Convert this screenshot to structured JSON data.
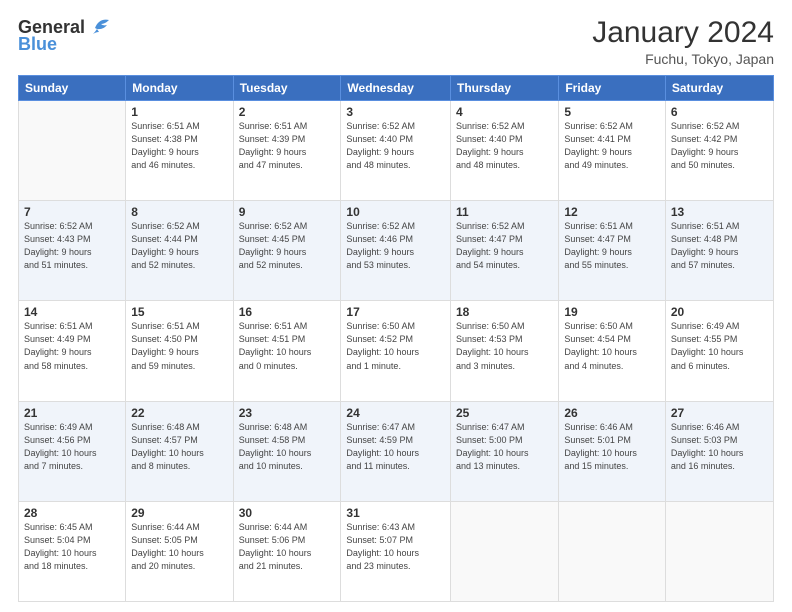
{
  "header": {
    "logo_line1": "General",
    "logo_line2": "Blue",
    "month_title": "January 2024",
    "location": "Fuchu, Tokyo, Japan"
  },
  "weekdays": [
    "Sunday",
    "Monday",
    "Tuesday",
    "Wednesday",
    "Thursday",
    "Friday",
    "Saturday"
  ],
  "weeks": [
    [
      {
        "day": "",
        "info": ""
      },
      {
        "day": "1",
        "info": "Sunrise: 6:51 AM\nSunset: 4:38 PM\nDaylight: 9 hours\nand 46 minutes."
      },
      {
        "day": "2",
        "info": "Sunrise: 6:51 AM\nSunset: 4:39 PM\nDaylight: 9 hours\nand 47 minutes."
      },
      {
        "day": "3",
        "info": "Sunrise: 6:52 AM\nSunset: 4:40 PM\nDaylight: 9 hours\nand 48 minutes."
      },
      {
        "day": "4",
        "info": "Sunrise: 6:52 AM\nSunset: 4:40 PM\nDaylight: 9 hours\nand 48 minutes."
      },
      {
        "day": "5",
        "info": "Sunrise: 6:52 AM\nSunset: 4:41 PM\nDaylight: 9 hours\nand 49 minutes."
      },
      {
        "day": "6",
        "info": "Sunrise: 6:52 AM\nSunset: 4:42 PM\nDaylight: 9 hours\nand 50 minutes."
      }
    ],
    [
      {
        "day": "7",
        "info": "Sunrise: 6:52 AM\nSunset: 4:43 PM\nDaylight: 9 hours\nand 51 minutes."
      },
      {
        "day": "8",
        "info": "Sunrise: 6:52 AM\nSunset: 4:44 PM\nDaylight: 9 hours\nand 52 minutes."
      },
      {
        "day": "9",
        "info": "Sunrise: 6:52 AM\nSunset: 4:45 PM\nDaylight: 9 hours\nand 52 minutes."
      },
      {
        "day": "10",
        "info": "Sunrise: 6:52 AM\nSunset: 4:46 PM\nDaylight: 9 hours\nand 53 minutes."
      },
      {
        "day": "11",
        "info": "Sunrise: 6:52 AM\nSunset: 4:47 PM\nDaylight: 9 hours\nand 54 minutes."
      },
      {
        "day": "12",
        "info": "Sunrise: 6:51 AM\nSunset: 4:47 PM\nDaylight: 9 hours\nand 55 minutes."
      },
      {
        "day": "13",
        "info": "Sunrise: 6:51 AM\nSunset: 4:48 PM\nDaylight: 9 hours\nand 57 minutes."
      }
    ],
    [
      {
        "day": "14",
        "info": "Sunrise: 6:51 AM\nSunset: 4:49 PM\nDaylight: 9 hours\nand 58 minutes."
      },
      {
        "day": "15",
        "info": "Sunrise: 6:51 AM\nSunset: 4:50 PM\nDaylight: 9 hours\nand 59 minutes."
      },
      {
        "day": "16",
        "info": "Sunrise: 6:51 AM\nSunset: 4:51 PM\nDaylight: 10 hours\nand 0 minutes."
      },
      {
        "day": "17",
        "info": "Sunrise: 6:50 AM\nSunset: 4:52 PM\nDaylight: 10 hours\nand 1 minute."
      },
      {
        "day": "18",
        "info": "Sunrise: 6:50 AM\nSunset: 4:53 PM\nDaylight: 10 hours\nand 3 minutes."
      },
      {
        "day": "19",
        "info": "Sunrise: 6:50 AM\nSunset: 4:54 PM\nDaylight: 10 hours\nand 4 minutes."
      },
      {
        "day": "20",
        "info": "Sunrise: 6:49 AM\nSunset: 4:55 PM\nDaylight: 10 hours\nand 6 minutes."
      }
    ],
    [
      {
        "day": "21",
        "info": "Sunrise: 6:49 AM\nSunset: 4:56 PM\nDaylight: 10 hours\nand 7 minutes."
      },
      {
        "day": "22",
        "info": "Sunrise: 6:48 AM\nSunset: 4:57 PM\nDaylight: 10 hours\nand 8 minutes."
      },
      {
        "day": "23",
        "info": "Sunrise: 6:48 AM\nSunset: 4:58 PM\nDaylight: 10 hours\nand 10 minutes."
      },
      {
        "day": "24",
        "info": "Sunrise: 6:47 AM\nSunset: 4:59 PM\nDaylight: 10 hours\nand 11 minutes."
      },
      {
        "day": "25",
        "info": "Sunrise: 6:47 AM\nSunset: 5:00 PM\nDaylight: 10 hours\nand 13 minutes."
      },
      {
        "day": "26",
        "info": "Sunrise: 6:46 AM\nSunset: 5:01 PM\nDaylight: 10 hours\nand 15 minutes."
      },
      {
        "day": "27",
        "info": "Sunrise: 6:46 AM\nSunset: 5:03 PM\nDaylight: 10 hours\nand 16 minutes."
      }
    ],
    [
      {
        "day": "28",
        "info": "Sunrise: 6:45 AM\nSunset: 5:04 PM\nDaylight: 10 hours\nand 18 minutes."
      },
      {
        "day": "29",
        "info": "Sunrise: 6:44 AM\nSunset: 5:05 PM\nDaylight: 10 hours\nand 20 minutes."
      },
      {
        "day": "30",
        "info": "Sunrise: 6:44 AM\nSunset: 5:06 PM\nDaylight: 10 hours\nand 21 minutes."
      },
      {
        "day": "31",
        "info": "Sunrise: 6:43 AM\nSunset: 5:07 PM\nDaylight: 10 hours\nand 23 minutes."
      },
      {
        "day": "",
        "info": ""
      },
      {
        "day": "",
        "info": ""
      },
      {
        "day": "",
        "info": ""
      }
    ]
  ]
}
